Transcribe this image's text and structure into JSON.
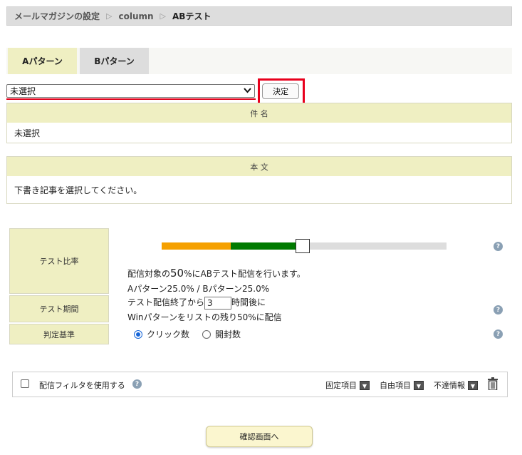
{
  "breadcrumb": {
    "items": [
      "メールマガジンの設定",
      "column"
    ],
    "current": "ABテスト",
    "separator": "▷"
  },
  "tabs": [
    {
      "label": "Aパターン",
      "active": true
    },
    {
      "label": "Bパターン",
      "active": false
    }
  ],
  "article_select": {
    "value": "未選択"
  },
  "decide_button": {
    "label": "決定"
  },
  "subject_box": {
    "header": "件 名",
    "value": "未選択"
  },
  "body_box": {
    "header": "本 文",
    "value": "下書き記事を選択してください。"
  },
  "test_settings": {
    "ratio_label": "テスト比率",
    "period_label": "テスト期間",
    "criteria_label": "判定基準",
    "slider": {
      "a_percent": 25.0,
      "b_percent": 25.0,
      "test_percent": 50
    },
    "ratio_text_prefix": "配信対象の",
    "ratio_text_value": "50",
    "ratio_text_suffix": "%にABテスト配信を行います。",
    "ratio_breakdown": "Aパターン25.0% / Bパターン25.0%",
    "period_prefix": "テスト配信終了から",
    "period_hours": "3",
    "period_suffix": "時間後に",
    "period_line2": "Winパターンをリストの残り50%に配信",
    "criteria_options": [
      {
        "label": "クリック数",
        "selected": true
      },
      {
        "label": "開封数",
        "selected": false
      }
    ],
    "help_glyph": "?"
  },
  "filter_bar": {
    "label": "配信フィルタを使用する",
    "checked": false,
    "dropdowns": [
      "固定項目",
      "自由項目",
      "不達情報"
    ],
    "dropdown_glyph": "▼"
  },
  "confirm_button": {
    "label": "確認画面へ"
  },
  "colors": {
    "accent_yellow": "#efefc2",
    "red_highlight": "#e8001c",
    "slider_orange": "#f5a000",
    "slider_green": "#007a00"
  }
}
